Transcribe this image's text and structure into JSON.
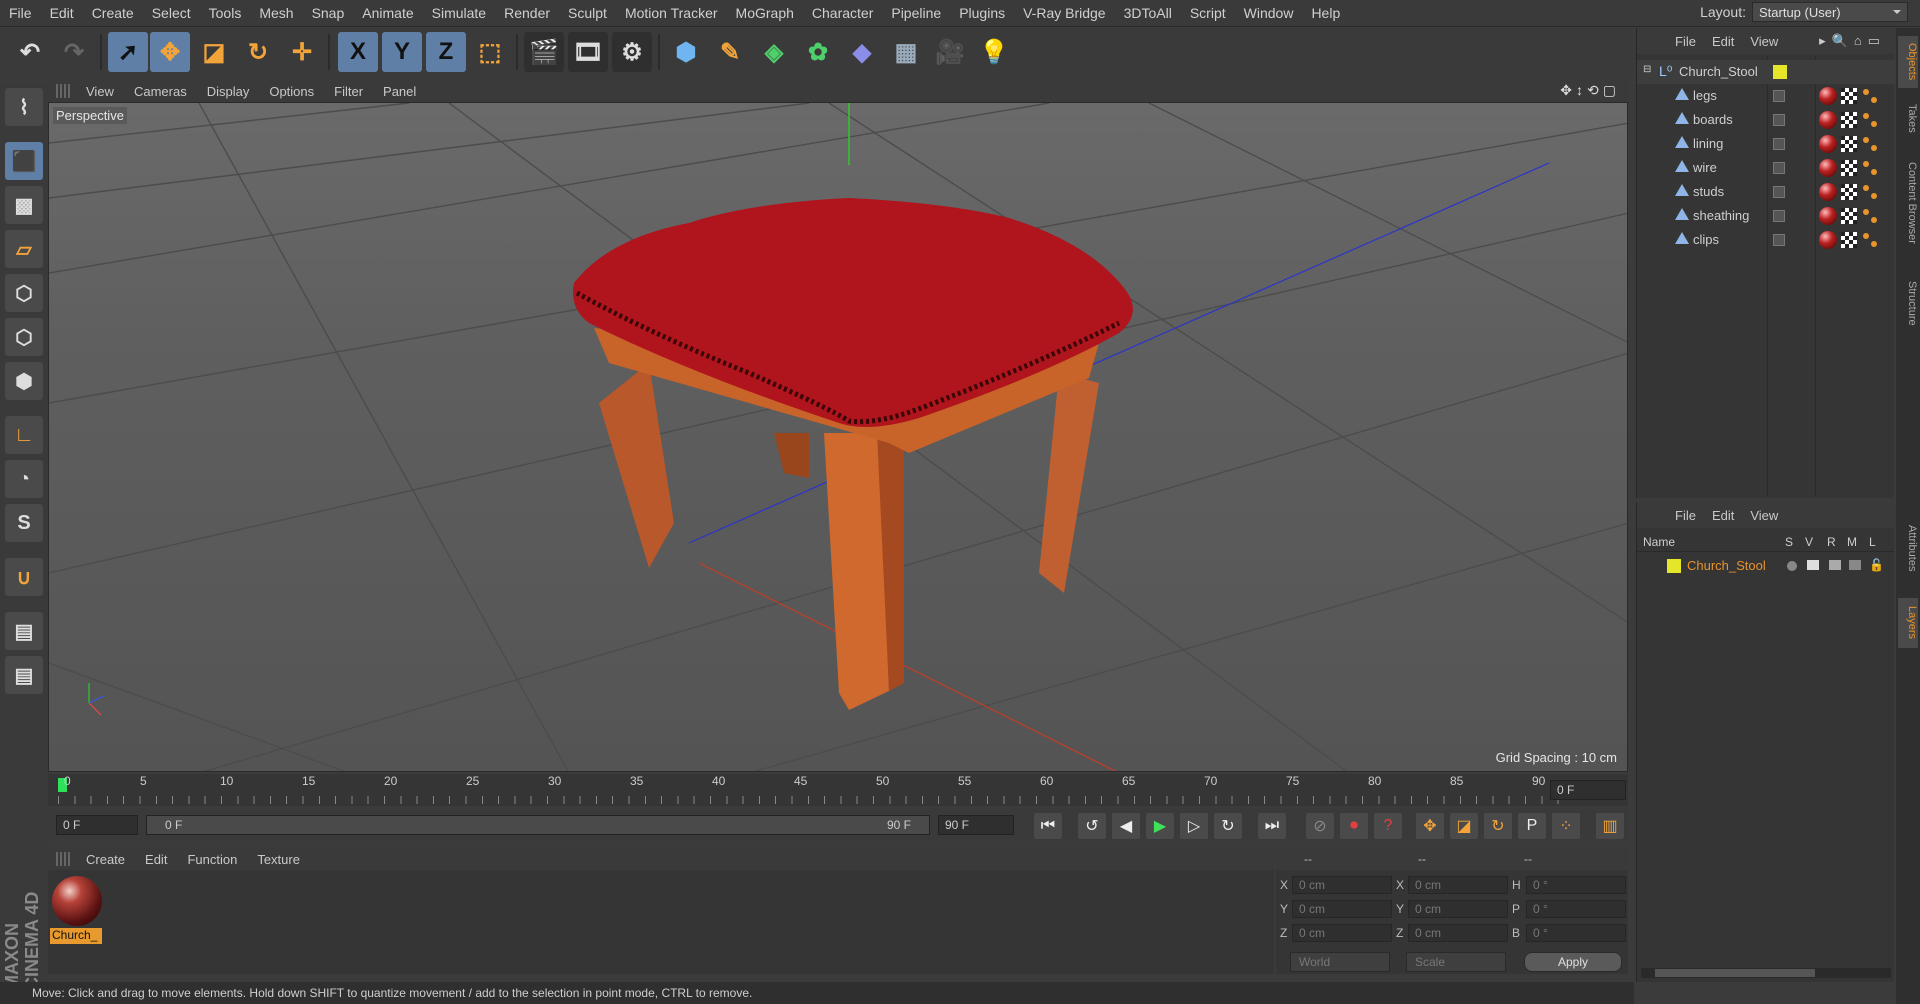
{
  "menu": {
    "items": [
      "File",
      "Edit",
      "Create",
      "Select",
      "Tools",
      "Mesh",
      "Snap",
      "Animate",
      "Simulate",
      "Render",
      "Sculpt",
      "Motion Tracker",
      "MoGraph",
      "Character",
      "Pipeline",
      "Plugins",
      "V-Ray Bridge",
      "3DToAll",
      "Script",
      "Window",
      "Help"
    ],
    "layout_label": "Layout:",
    "layout_value": "Startup (User)"
  },
  "toolbar": {
    "x_label": "X",
    "y_label": "Y",
    "z_label": "Z"
  },
  "viewport": {
    "menu": [
      "View",
      "Cameras",
      "Display",
      "Options",
      "Filter",
      "Panel"
    ],
    "camera_label": "Perspective",
    "grid_spacing": "Grid Spacing : 10 cm"
  },
  "timeline": {
    "ticks": [
      "0",
      "5",
      "10",
      "15",
      "20",
      "25",
      "30",
      "35",
      "40",
      "45",
      "50",
      "55",
      "60",
      "65",
      "70",
      "75",
      "80",
      "85",
      "90"
    ],
    "current_frame": "0 F",
    "start": "0 F",
    "range_start": "0 F",
    "range_end": "90 F",
    "end": "90 F"
  },
  "material_manager": {
    "menu": [
      "Create",
      "Edit",
      "Function",
      "Texture"
    ],
    "material_name": "Church_"
  },
  "coordinates": {
    "header": [
      "--",
      "--",
      "--"
    ],
    "rows": [
      {
        "a": "X",
        "av": "0 cm",
        "b": "X",
        "bv": "0 cm",
        "c": "H",
        "cv": "0 °"
      },
      {
        "a": "Y",
        "av": "0 cm",
        "b": "Y",
        "bv": "0 cm",
        "c": "P",
        "cv": "0 °"
      },
      {
        "a": "Z",
        "av": "0 cm",
        "b": "Z",
        "bv": "0 cm",
        "c": "B",
        "cv": "0 °"
      }
    ],
    "space": "World",
    "mode": "Scale",
    "apply": "Apply"
  },
  "status": "Move: Click and drag to move elements. Hold down SHIFT to quantize movement / add to the selection in point mode, CTRL to remove.",
  "objects": {
    "menu": [
      "File",
      "Edit",
      "View"
    ],
    "root": "Church_Stool",
    "children": [
      "legs",
      "boards",
      "lining",
      "wire",
      "studs",
      "sheathing",
      "clips"
    ]
  },
  "layers": {
    "menu": [
      "File",
      "Edit",
      "View"
    ],
    "columns": [
      "Name",
      "S",
      "V",
      "R",
      "M",
      "L"
    ],
    "items": [
      "Church_Stool"
    ]
  },
  "side_tabs": [
    "Objects",
    "Takes",
    "Content Browser",
    "Structure",
    "Attributes",
    "Layers"
  ],
  "brand": "MAXON CINEMA 4D",
  "colors": {
    "accent": "#e8932b",
    "selection_blue": "#5f7fa6",
    "stool_red": "#b0141c",
    "wood": "#c8642a"
  }
}
